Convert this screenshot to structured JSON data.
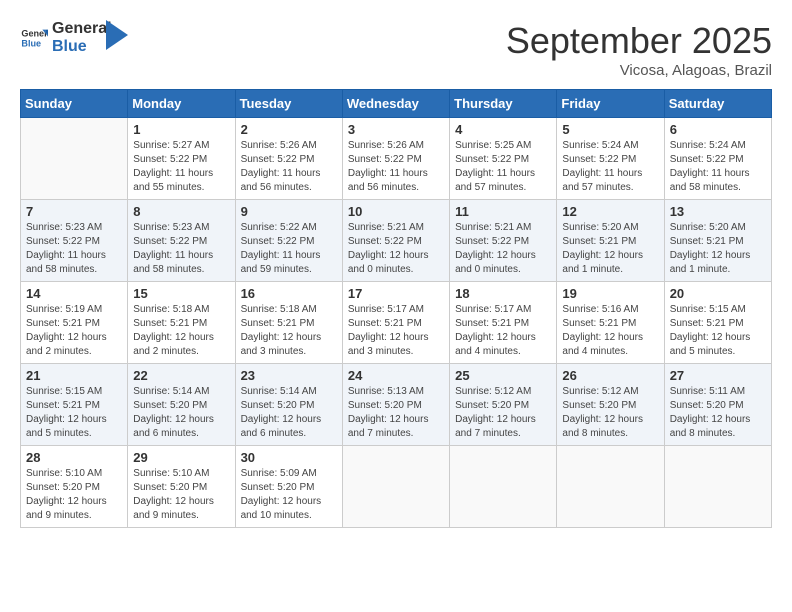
{
  "logo": {
    "text_general": "General",
    "text_blue": "Blue"
  },
  "title": {
    "month_year": "September 2025",
    "location": "Vicosa, Alagoas, Brazil"
  },
  "weekdays": [
    "Sunday",
    "Monday",
    "Tuesday",
    "Wednesday",
    "Thursday",
    "Friday",
    "Saturday"
  ],
  "weeks": [
    [
      {
        "day": "",
        "empty": true
      },
      {
        "day": "1",
        "sunrise": "Sunrise: 5:27 AM",
        "sunset": "Sunset: 5:22 PM",
        "daylight": "Daylight: 11 hours and 55 minutes."
      },
      {
        "day": "2",
        "sunrise": "Sunrise: 5:26 AM",
        "sunset": "Sunset: 5:22 PM",
        "daylight": "Daylight: 11 hours and 56 minutes."
      },
      {
        "day": "3",
        "sunrise": "Sunrise: 5:26 AM",
        "sunset": "Sunset: 5:22 PM",
        "daylight": "Daylight: 11 hours and 56 minutes."
      },
      {
        "day": "4",
        "sunrise": "Sunrise: 5:25 AM",
        "sunset": "Sunset: 5:22 PM",
        "daylight": "Daylight: 11 hours and 57 minutes."
      },
      {
        "day": "5",
        "sunrise": "Sunrise: 5:24 AM",
        "sunset": "Sunset: 5:22 PM",
        "daylight": "Daylight: 11 hours and 57 minutes."
      },
      {
        "day": "6",
        "sunrise": "Sunrise: 5:24 AM",
        "sunset": "Sunset: 5:22 PM",
        "daylight": "Daylight: 11 hours and 58 minutes."
      }
    ],
    [
      {
        "day": "7",
        "sunrise": "Sunrise: 5:23 AM",
        "sunset": "Sunset: 5:22 PM",
        "daylight": "Daylight: 11 hours and 58 minutes."
      },
      {
        "day": "8",
        "sunrise": "Sunrise: 5:23 AM",
        "sunset": "Sunset: 5:22 PM",
        "daylight": "Daylight: 11 hours and 58 minutes."
      },
      {
        "day": "9",
        "sunrise": "Sunrise: 5:22 AM",
        "sunset": "Sunset: 5:22 PM",
        "daylight": "Daylight: 11 hours and 59 minutes."
      },
      {
        "day": "10",
        "sunrise": "Sunrise: 5:21 AM",
        "sunset": "Sunset: 5:22 PM",
        "daylight": "Daylight: 12 hours and 0 minutes."
      },
      {
        "day": "11",
        "sunrise": "Sunrise: 5:21 AM",
        "sunset": "Sunset: 5:22 PM",
        "daylight": "Daylight: 12 hours and 0 minutes."
      },
      {
        "day": "12",
        "sunrise": "Sunrise: 5:20 AM",
        "sunset": "Sunset: 5:21 PM",
        "daylight": "Daylight: 12 hours and 1 minute."
      },
      {
        "day": "13",
        "sunrise": "Sunrise: 5:20 AM",
        "sunset": "Sunset: 5:21 PM",
        "daylight": "Daylight: 12 hours and 1 minute."
      }
    ],
    [
      {
        "day": "14",
        "sunrise": "Sunrise: 5:19 AM",
        "sunset": "Sunset: 5:21 PM",
        "daylight": "Daylight: 12 hours and 2 minutes."
      },
      {
        "day": "15",
        "sunrise": "Sunrise: 5:18 AM",
        "sunset": "Sunset: 5:21 PM",
        "daylight": "Daylight: 12 hours and 2 minutes."
      },
      {
        "day": "16",
        "sunrise": "Sunrise: 5:18 AM",
        "sunset": "Sunset: 5:21 PM",
        "daylight": "Daylight: 12 hours and 3 minutes."
      },
      {
        "day": "17",
        "sunrise": "Sunrise: 5:17 AM",
        "sunset": "Sunset: 5:21 PM",
        "daylight": "Daylight: 12 hours and 3 minutes."
      },
      {
        "day": "18",
        "sunrise": "Sunrise: 5:17 AM",
        "sunset": "Sunset: 5:21 PM",
        "daylight": "Daylight: 12 hours and 4 minutes."
      },
      {
        "day": "19",
        "sunrise": "Sunrise: 5:16 AM",
        "sunset": "Sunset: 5:21 PM",
        "daylight": "Daylight: 12 hours and 4 minutes."
      },
      {
        "day": "20",
        "sunrise": "Sunrise: 5:15 AM",
        "sunset": "Sunset: 5:21 PM",
        "daylight": "Daylight: 12 hours and 5 minutes."
      }
    ],
    [
      {
        "day": "21",
        "sunrise": "Sunrise: 5:15 AM",
        "sunset": "Sunset: 5:21 PM",
        "daylight": "Daylight: 12 hours and 5 minutes."
      },
      {
        "day": "22",
        "sunrise": "Sunrise: 5:14 AM",
        "sunset": "Sunset: 5:20 PM",
        "daylight": "Daylight: 12 hours and 6 minutes."
      },
      {
        "day": "23",
        "sunrise": "Sunrise: 5:14 AM",
        "sunset": "Sunset: 5:20 PM",
        "daylight": "Daylight: 12 hours and 6 minutes."
      },
      {
        "day": "24",
        "sunrise": "Sunrise: 5:13 AM",
        "sunset": "Sunset: 5:20 PM",
        "daylight": "Daylight: 12 hours and 7 minutes."
      },
      {
        "day": "25",
        "sunrise": "Sunrise: 5:12 AM",
        "sunset": "Sunset: 5:20 PM",
        "daylight": "Daylight: 12 hours and 7 minutes."
      },
      {
        "day": "26",
        "sunrise": "Sunrise: 5:12 AM",
        "sunset": "Sunset: 5:20 PM",
        "daylight": "Daylight: 12 hours and 8 minutes."
      },
      {
        "day": "27",
        "sunrise": "Sunrise: 5:11 AM",
        "sunset": "Sunset: 5:20 PM",
        "daylight": "Daylight: 12 hours and 8 minutes."
      }
    ],
    [
      {
        "day": "28",
        "sunrise": "Sunrise: 5:10 AM",
        "sunset": "Sunset: 5:20 PM",
        "daylight": "Daylight: 12 hours and 9 minutes."
      },
      {
        "day": "29",
        "sunrise": "Sunrise: 5:10 AM",
        "sunset": "Sunset: 5:20 PM",
        "daylight": "Daylight: 12 hours and 9 minutes."
      },
      {
        "day": "30",
        "sunrise": "Sunrise: 5:09 AM",
        "sunset": "Sunset: 5:20 PM",
        "daylight": "Daylight: 12 hours and 10 minutes."
      },
      {
        "day": "",
        "empty": true
      },
      {
        "day": "",
        "empty": true
      },
      {
        "day": "",
        "empty": true
      },
      {
        "day": "",
        "empty": true
      }
    ]
  ]
}
